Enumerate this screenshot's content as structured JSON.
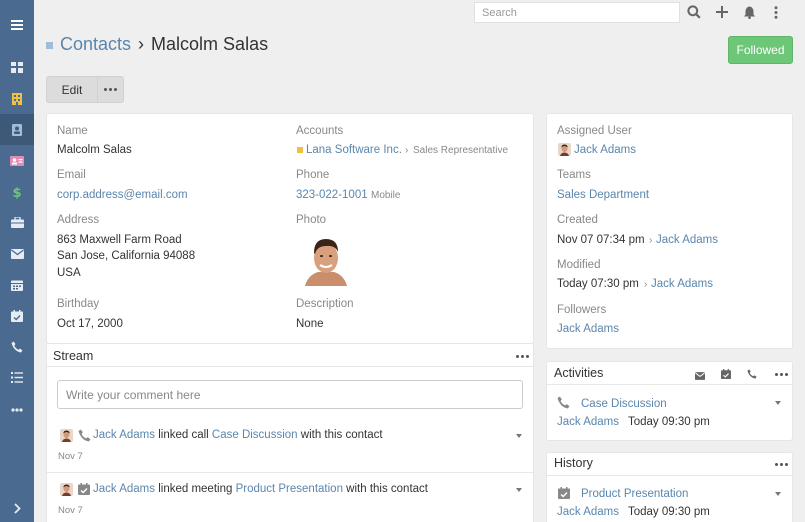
{
  "topbar": {
    "search_placeholder": "Search"
  },
  "header": {
    "breadcrumb": "Contacts",
    "separator": "›",
    "title": "Malcolm Salas",
    "followed_label": "Followed"
  },
  "actions": {
    "edit_label": "Edit"
  },
  "detail": {
    "name_label": "Name",
    "name": "Malcolm Salas",
    "accounts_label": "Accounts",
    "account_name": "Lana Software Inc.",
    "account_sep": "›",
    "account_role": "Sales Representative",
    "email_label": "Email",
    "email": "corp.address@email.com",
    "phone_label": "Phone",
    "phone": "323-022-1001",
    "phone_type": "Mobile",
    "address_label": "Address",
    "address_line1": "863 Maxwell Farm Road",
    "address_line2": "San Jose, California 94088",
    "address_line3": "USA",
    "photo_label": "Photo",
    "birthday_label": "Birthday",
    "birthday": "Oct 17, 2000",
    "description_label": "Description",
    "description": "None"
  },
  "stream": {
    "title": "Stream",
    "comment_placeholder": "Write your comment here",
    "entries": [
      {
        "user": "Jack Adams",
        "action": "linked call",
        "target": "Case Discussion",
        "suffix": "with this contact",
        "date": "Nov 7"
      },
      {
        "user": "Jack Adams",
        "action": "linked meeting",
        "target": "Product Presentation",
        "suffix": "with this contact",
        "date": "Nov 7"
      }
    ]
  },
  "side": {
    "assigned_user_label": "Assigned User",
    "assigned_user": "Jack Adams",
    "teams_label": "Teams",
    "team": "Sales Department",
    "created_label": "Created",
    "created": "Nov 07 07:34 pm",
    "created_sep": "›",
    "created_by": "Jack Adams",
    "modified_label": "Modified",
    "modified": "Today 07:30 pm",
    "modified_sep": "›",
    "modified_by": "Jack Adams",
    "followers_label": "Followers",
    "follower": "Jack Adams"
  },
  "activities": {
    "title": "Activities",
    "item_name": "Case Discussion",
    "item_user": "Jack Adams",
    "item_time": "Today 09:30 pm"
  },
  "history": {
    "title": "History",
    "item_name": "Product Presentation",
    "item_user": "Jack Adams",
    "item_time": "Today 09:30 pm"
  },
  "colors": {
    "sidebar": "#4b6a8f",
    "link": "#5a86ad",
    "followed": "#6ec778",
    "account_marker": "#f0c040"
  }
}
